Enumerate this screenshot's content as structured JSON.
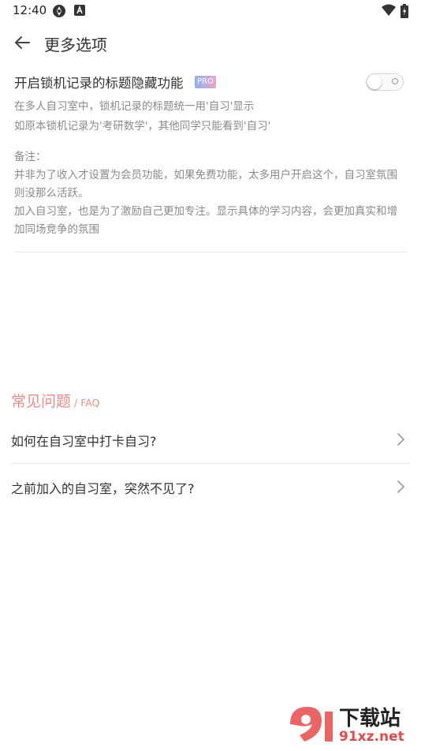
{
  "status_bar": {
    "time": "12:40"
  },
  "header": {
    "title": "更多选项"
  },
  "setting": {
    "title": "开启锁机记录的标题隐藏功能",
    "badge": "PRO",
    "desc_line1": "在多人自习室中，锁机记录的标题统一用'自习'显示",
    "desc_line2": "如原本锁机记录为'考研数学'，其他同学只能看到'自习'",
    "toggle_on": false
  },
  "note": {
    "label": "备注：",
    "line1": "并非为了收入才设置为会员功能，如果免费功能，太多用户开启这个，自习室氛围则没那么活跃。",
    "line2": "加入自习室，也是为了激励自己更加专注。显示具体的学习内容，会更加真实和增加同场竞争的氛围"
  },
  "faq": {
    "title": "常见问题",
    "subtitle": "/ FAQ",
    "items": [
      {
        "label": "如何在自习室中打卡自习?"
      },
      {
        "label": "之前加入的自习室，突然不见了?"
      }
    ]
  },
  "watermark": {
    "text1": "下载站",
    "text2": "91xz.net"
  },
  "colors": {
    "accent": "#f08a88",
    "text": "#333333",
    "muted": "#8a8a8a"
  }
}
